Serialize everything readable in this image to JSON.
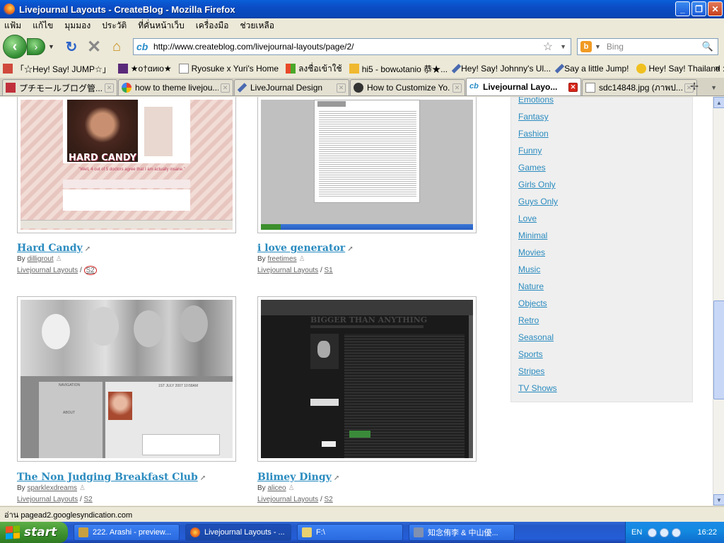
{
  "window": {
    "title": "Livejournal Layouts - CreateBlog - Mozilla Firefox",
    "buttons": {
      "minimize": "_",
      "maximize": "❐",
      "close": "✕"
    }
  },
  "menu": [
    "แฟ้ม",
    "แก้ไข",
    "มุมมอง",
    "ประวัติ",
    "ที่คั่นหน้าเว็บ",
    "เครื่องมือ",
    "ช่วยเหลือ"
  ],
  "nav": {
    "url": "http://www.createblog.com/livejournal-layouts/page/2/",
    "search_placeholder": "Bing"
  },
  "bookmarks": [
    {
      "label": "「☆Hey! Say! JUMP☆」",
      "color": "#d04a3c"
    },
    {
      "label": "★o†αиιo★",
      "color": "#5a2a7a"
    },
    {
      "label": "Ryosuke x Yuri's Home",
      "color": "#ffffff"
    },
    {
      "label": "ลงชื่อเข้าใช้",
      "color": "#3a78d8"
    },
    {
      "label": "hi5 - bowωtanio 恭★...",
      "color": "#f0b830"
    },
    {
      "label": "Hey! Say! Johnny's Ul...",
      "color": "#4a6ab0"
    },
    {
      "label": "Say a little Jump!",
      "color": "#4a6ab0"
    },
    {
      "label": "Hey! Say! Thailand :) ...",
      "color": "#f0c020"
    }
  ],
  "bookmarks_more": "»",
  "tabs": [
    {
      "label": "プチモールブログ管...",
      "color": "#c0303c",
      "active": false
    },
    {
      "label": "how to theme livejou...",
      "color": "#4285f4",
      "active": false
    },
    {
      "label": "LiveJournal Design",
      "color": "#4a6ab0",
      "active": false
    },
    {
      "label": "How to Customize Yo...",
      "color": "#333333",
      "active": false
    },
    {
      "label": "Livejournal Layo...",
      "color": "#2a8ec9",
      "active": true
    },
    {
      "label": "sdc14848.jpg (ภาพป...",
      "color": "#ffffff",
      "active": false
    }
  ],
  "layouts": [
    {
      "title": "Hard Candy",
      "by_label": "By",
      "author": "dilligrout",
      "category": "Livejournal Layouts",
      "style": "S2"
    },
    {
      "title": "i love generator",
      "by_label": "By",
      "author": "freetimes",
      "category": "Livejournal Layouts",
      "style": "S1"
    },
    {
      "title": "The Non Judging Breakfast Club",
      "by_label": "By",
      "author": "sparklexdreams",
      "category": "Livejournal Layouts",
      "style": "S2"
    },
    {
      "title": "Blimey Dingy",
      "by_label": "By",
      "author": "aliceo",
      "category": "Livejournal Layouts",
      "style": "S2"
    }
  ],
  "thumb_texts": {
    "hard_candy_banner": "HARD CANDY",
    "hard_candy_quote": "\"Well, 4 out of 5 doctors agree that I am actually insane.\"",
    "blimey_banner": "BIGGER THAN ANYTHING",
    "breakfast_nav": "NAVIGATION",
    "breakfast_about": "ABOUT",
    "breakfast_date": "1ST JULY 2007 10:58AM"
  },
  "sidebar": {
    "categories": [
      "Emotions",
      "Fantasy",
      "Fashion",
      "Funny",
      "Games",
      "Girls Only",
      "Guys Only",
      "Love",
      "Minimal",
      "Movies",
      "Music",
      "Nature",
      "Objects",
      "Retro",
      "Seasonal",
      "Sports",
      "Stripes",
      "TV Shows"
    ]
  },
  "status": "อ่าน pagead2.googlesyndication.com",
  "taskbar": {
    "start": "start",
    "tasks": [
      {
        "label": "222. Arashi - preview...",
        "color": "#c9a040"
      },
      {
        "label": "Livejournal Layouts - ...",
        "color": "#e8641b",
        "active": true
      },
      {
        "label": "F:\\",
        "color": "#e8d070"
      },
      {
        "label": "知念侑李 & 中山優...",
        "color": "#8090b0"
      }
    ],
    "lang": "EN",
    "clock": "16:22"
  },
  "colors": {
    "link": "#2a8bbf",
    "title_bar": "#0b4cc4",
    "taskbar": "#245dd7"
  }
}
